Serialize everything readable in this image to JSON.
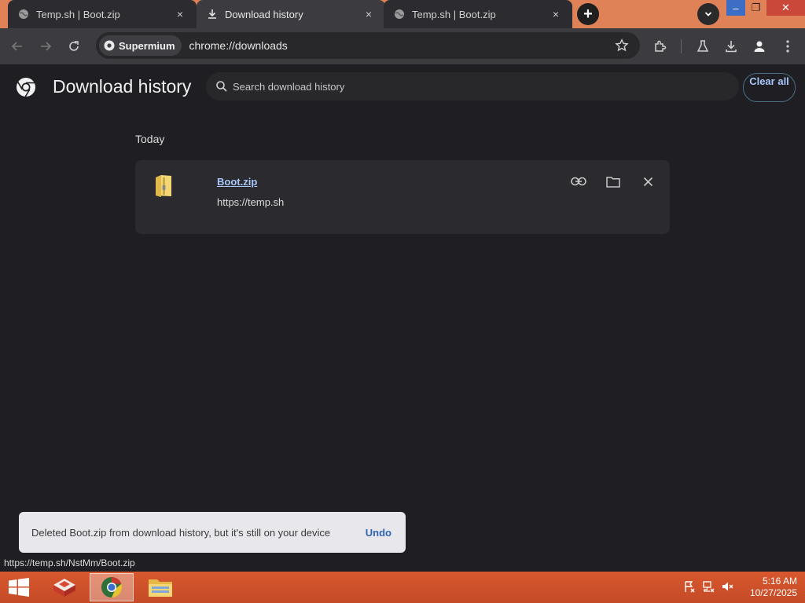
{
  "tabs": [
    {
      "title": "Temp.sh | Boot.zip",
      "icon": "globe-icon",
      "active": false
    },
    {
      "title": "Download history",
      "icon": "download-icon",
      "active": true
    },
    {
      "title": "Temp.sh | Boot.zip",
      "icon": "globe-icon",
      "active": false
    }
  ],
  "tab_close_glyph": "×",
  "new_tab_glyph": "+",
  "window_controls": {
    "minimize": "–",
    "maximize": "❐",
    "close": "✕"
  },
  "omnibox": {
    "site_chip": "Supermium",
    "url": "chrome://downloads"
  },
  "page": {
    "title": "Download history",
    "search_placeholder": "Search download history",
    "clear_all": "Clear all"
  },
  "downloads": {
    "date_heading": "Today",
    "items": [
      {
        "file_name": "Boot.zip",
        "source": "https://temp.sh",
        "icon": "zip-folder-icon"
      }
    ]
  },
  "toast": {
    "message": "Deleted Boot.zip from download history, but it's still on your device",
    "action": "Undo"
  },
  "status_url": "https://temp.sh/NstMm/Boot.zip",
  "taskbar": {
    "apps": [
      "file-transfer-app",
      "supermium-browser",
      "file-explorer"
    ],
    "clock_time": "5:16 AM",
    "clock_date": "10/27/2025"
  },
  "colors": {
    "accent": "#a8c7fa",
    "titlebar": "#e08257",
    "taskbar": "#d8582e"
  }
}
